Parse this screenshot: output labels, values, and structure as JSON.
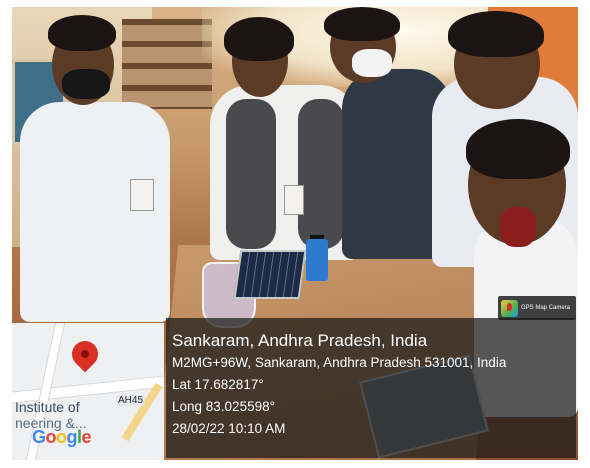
{
  "location": {
    "title": "Sankaram, Andhra Pradesh, India",
    "address": "M2MG+96W, Sankaram, Andhra Pradesh 531001, India",
    "latitude": "Lat 17.682817°",
    "longitude": "Long 83.025598°",
    "datetime": "28/02/22 10:10 AM"
  },
  "map": {
    "label_line1": "Institute of",
    "label_line2": "neering &...",
    "route_label": "AH45",
    "logo_letters": [
      "G",
      "o",
      "o",
      "g",
      "l",
      "e"
    ]
  },
  "badge": {
    "text": "GPS Map Camera",
    "icon": "gps-map-camera-icon"
  },
  "colors": {
    "overlay": "#191919",
    "pin": "#d93025",
    "text": "#ffffff"
  }
}
